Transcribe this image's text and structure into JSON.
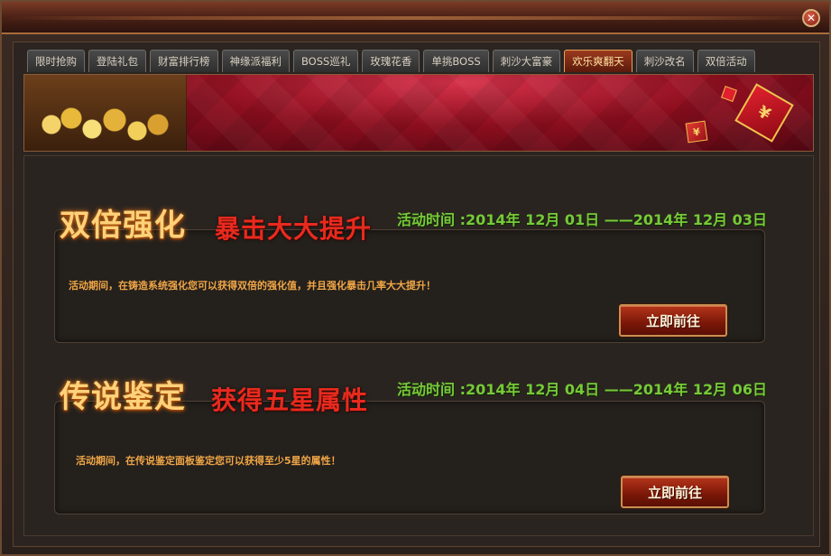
{
  "window": {
    "close_glyph": "✕"
  },
  "tabs": [
    {
      "label": "限时抢购"
    },
    {
      "label": "登陆礼包"
    },
    {
      "label": "财富排行榜"
    },
    {
      "label": "神缘派福利"
    },
    {
      "label": "BOSS巡礼"
    },
    {
      "label": "玫瑰花香"
    },
    {
      "label": "单挑BOSS"
    },
    {
      "label": "刺沙大富豪"
    },
    {
      "label": "欢乐爽翻天",
      "active": true
    },
    {
      "label": "刺沙改名"
    },
    {
      "label": "双倍活动"
    }
  ],
  "banner": {
    "envelope_big_glyph": "¥",
    "envelope_small_glyph": "¥"
  },
  "events": [
    {
      "title": "双倍强化",
      "subtitle": "暴击大大提升",
      "date": "活动时间 :2014年 12月 01日 ——2014年 12月 03日",
      "description": "活动期间，在铸造系统强化您可以获得双倍的强化值，并且强化暴击几率大大提升！",
      "button": "立即前往"
    },
    {
      "title": "传说鉴定",
      "subtitle": "获得五星属性",
      "date": "活动时间 :2014年 12月 04日 ——2014年 12月 06日",
      "description": "活动期间，在传说鉴定面板鉴定您可以获得至少5星的属性！",
      "button": "立即前往"
    }
  ],
  "colors": {
    "title": "#ffd27a",
    "subtitle": "#e82a1e",
    "date": "#79c83a",
    "description": "#f1a646",
    "active_tab": "#9c3a1e"
  }
}
